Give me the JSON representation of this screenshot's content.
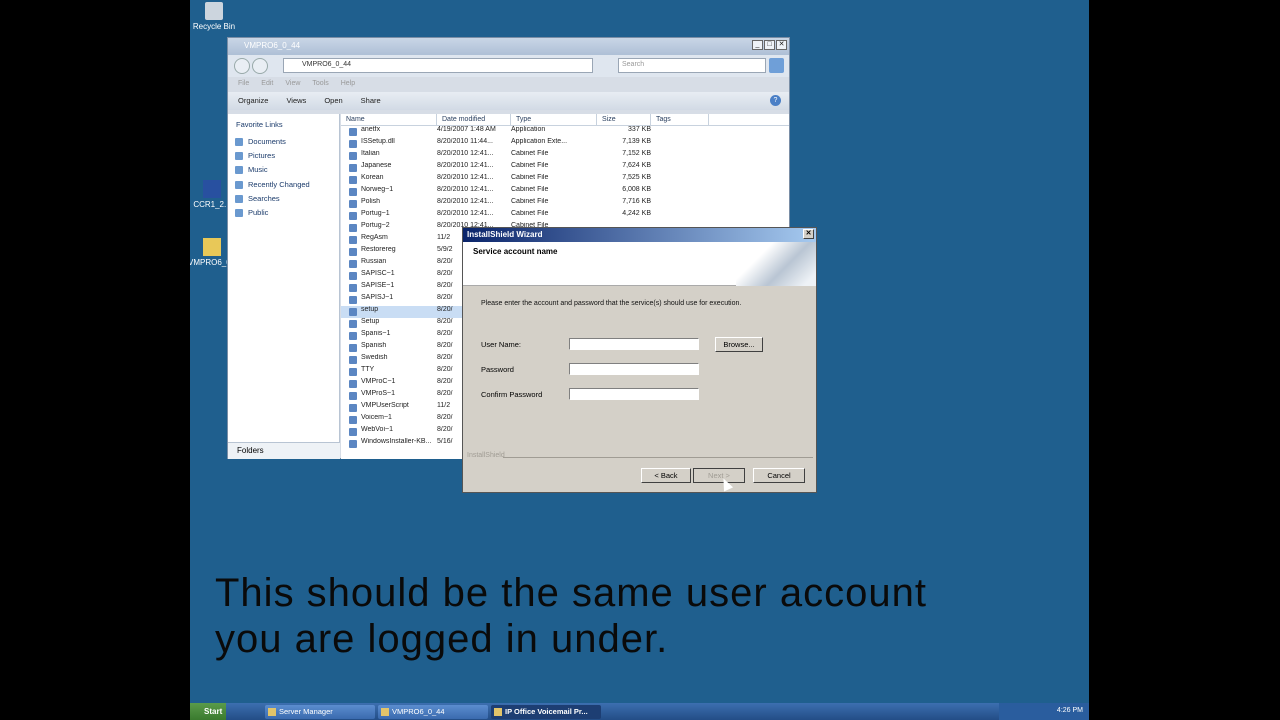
{
  "desktop": {
    "icons": [
      {
        "label": "Recycle Bin"
      },
      {
        "label": "CCR1_2..."
      },
      {
        "label": "VMPRO6_0..."
      }
    ]
  },
  "explorer": {
    "title": "VMPRO6_0_44",
    "address": "VMPRO6_0_44",
    "search_placeholder": "Search",
    "menu": [
      "File",
      "Edit",
      "View",
      "Tools",
      "Help"
    ],
    "toolbar": {
      "organize": "Organize",
      "views": "Views",
      "open": "Open",
      "share": "Share"
    },
    "nav": {
      "header": "Favorite Links",
      "items": [
        "Documents",
        "Pictures",
        "Music",
        "Recently Changed",
        "Searches",
        "Public"
      ],
      "folders_label": "Folders"
    },
    "columns": {
      "name": "Name",
      "date": "Date modified",
      "type": "Type",
      "size": "Size",
      "tags": "Tags"
    },
    "files": [
      {
        "name": "anetfx",
        "date": "4/19/2007 1:48 AM",
        "type": "Application",
        "size": "337 KB"
      },
      {
        "name": "ISSetup.dll",
        "date": "8/20/2010 11:44...",
        "type": "Application Exte...",
        "size": "7,139 KB"
      },
      {
        "name": "Italian",
        "date": "8/20/2010 12:41...",
        "type": "Cabinet File",
        "size": "7,152 KB"
      },
      {
        "name": "Japanese",
        "date": "8/20/2010 12:41...",
        "type": "Cabinet File",
        "size": "7,624 KB"
      },
      {
        "name": "Korean",
        "date": "8/20/2010 12:41...",
        "type": "Cabinet File",
        "size": "7,525 KB"
      },
      {
        "name": "Norweg~1",
        "date": "8/20/2010 12:41...",
        "type": "Cabinet File",
        "size": "6,008 KB"
      },
      {
        "name": "Polish",
        "date": "8/20/2010 12:41...",
        "type": "Cabinet File",
        "size": "7,716 KB"
      },
      {
        "name": "Portug~1",
        "date": "8/20/2010 12:41...",
        "type": "Cabinet File",
        "size": "4,242 KB"
      },
      {
        "name": "Portug~2",
        "date": "8/20/2010 12:41...",
        "type": "Cabinet File",
        "size": ""
      },
      {
        "name": "RegAsm",
        "date": "11/2",
        "type": "",
        "size": ""
      },
      {
        "name": "Restorereg",
        "date": "5/9/2",
        "type": "",
        "size": ""
      },
      {
        "name": "Russian",
        "date": "8/20/",
        "type": "",
        "size": ""
      },
      {
        "name": "SAPISC~1",
        "date": "8/20/",
        "type": "",
        "size": ""
      },
      {
        "name": "SAPISE~1",
        "date": "8/20/",
        "type": "",
        "size": ""
      },
      {
        "name": "SAPISJ~1",
        "date": "8/20/",
        "type": "",
        "size": ""
      },
      {
        "name": "setup",
        "date": "8/20/",
        "type": "",
        "size": ""
      },
      {
        "name": "Setup",
        "date": "8/20/",
        "type": "",
        "size": ""
      },
      {
        "name": "Spanis~1",
        "date": "8/20/",
        "type": "",
        "size": ""
      },
      {
        "name": "Spanish",
        "date": "8/20/",
        "type": "",
        "size": ""
      },
      {
        "name": "Swedish",
        "date": "8/20/",
        "type": "",
        "size": ""
      },
      {
        "name": "TTY",
        "date": "8/20/",
        "type": "",
        "size": ""
      },
      {
        "name": "VMProC~1",
        "date": "8/20/",
        "type": "",
        "size": ""
      },
      {
        "name": "VMProS~1",
        "date": "8/20/",
        "type": "",
        "size": ""
      },
      {
        "name": "VMPUserScript",
        "date": "11/2",
        "type": "",
        "size": ""
      },
      {
        "name": "Voicem~1",
        "date": "8/20/",
        "type": "",
        "size": ""
      },
      {
        "name": "WebVoi~1",
        "date": "8/20/",
        "type": "",
        "size": ""
      },
      {
        "name": "WindowsInstaller-KB...",
        "date": "5/16/",
        "type": "",
        "size": ""
      }
    ],
    "selected_file": "setup"
  },
  "dialog": {
    "title": "InstallShield Wizard",
    "header": "Service account name",
    "instruction": "Please enter the account and password that the service(s) should use for execution.",
    "fields": {
      "user_name": {
        "label": "User Name:",
        "value": ""
      },
      "password": {
        "label": "Password",
        "value": ""
      },
      "confirm": {
        "label": "Confirm Password",
        "value": ""
      }
    },
    "browse": "Browse...",
    "brand": "InstallShield",
    "back": "< Back",
    "next": "Next >",
    "cancel": "Cancel"
  },
  "caption": {
    "line1": "This should be the same user account",
    "line2": "you are logged in under."
  },
  "taskbar": {
    "start": "Start",
    "items": [
      {
        "label": "Server Manager"
      },
      {
        "label": "VMPRO6_0_44"
      },
      {
        "label": "IP Office Voicemail Pr..."
      }
    ],
    "clock": "4:26 PM"
  }
}
